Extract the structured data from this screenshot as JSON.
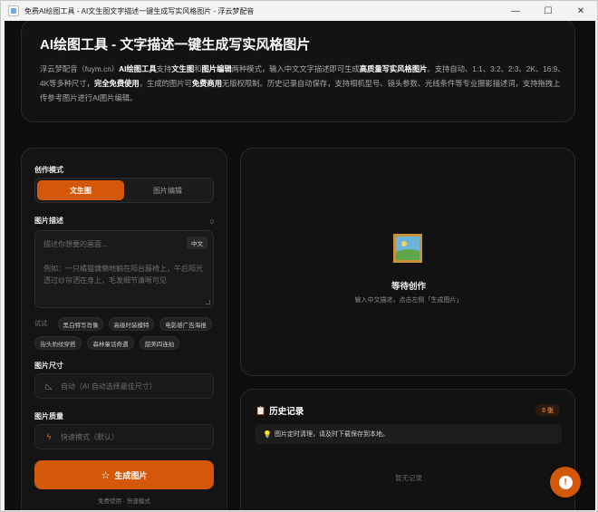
{
  "window": {
    "title": "免费AI绘图工具 - AI文生图文字描述一键生成写实风格图片 - 浮云梦配音",
    "minimize_glyph": "—",
    "maximize_glyph": "☐",
    "close_glyph": "✕"
  },
  "hero": {
    "title": "AI绘图工具 - 文字描述一键生成写实风格图片",
    "desc": [
      {
        "t": "浮云梦配音（fuym.cn）",
        "b": false
      },
      {
        "t": "AI绘图工具",
        "b": true
      },
      {
        "t": "支持",
        "b": false
      },
      {
        "t": "文生图",
        "b": true
      },
      {
        "t": "和",
        "b": false
      },
      {
        "t": "图片编辑",
        "b": true
      },
      {
        "t": "两种模式，输入中文文字描述即可生成",
        "b": false
      },
      {
        "t": "高质量写实风格图片",
        "b": true
      },
      {
        "t": "。支持自动、1:1、3:2、2:3、2K、16:9、4K等多种尺寸，",
        "b": false
      },
      {
        "t": "完全免费使用",
        "b": true
      },
      {
        "t": "，生成的图片可",
        "b": false
      },
      {
        "t": "免费商用",
        "b": true
      },
      {
        "t": "无版权限制。历史记录自动保存，支持相机型号、镜头参数、光线条件等专业摄影描述词，支持拖拽上传参考图片进行AI图片编辑。",
        "b": false
      }
    ]
  },
  "left": {
    "mode_label": "创作模式",
    "mode_tabs": [
      "文生图",
      "图片编辑"
    ],
    "active_mode": "文生图",
    "prompt_label": "图片描述",
    "char_count": "0",
    "prompt_placeholder": "描述你想要的画面...",
    "lang_badge": "中文",
    "prompt_example": "例如：一只橘猫慵懒地躺在阳台藤椅上，午后阳光透过纱帘洒在身上，毛发细节清晰可见",
    "try_label": "试试:",
    "chips": [
      "黑白特写肖像",
      "高级时装模特",
      "电影感广告海报",
      "街头豹纹穿搭",
      "森林童话奇遇",
      "甜美四连拍"
    ],
    "size_label": "图片尺寸",
    "size_value": "自动（AI 自动选择最佳尺寸）",
    "quality_label": "图片质量",
    "quality_value": "快速模式（默认）",
    "generate_label": "生成图片",
    "generate_sub": "免费使用 · 快速模式"
  },
  "preview": {
    "title": "等待创作",
    "subtitle": "输入中文描述，点击左侧「生成图片」"
  },
  "history": {
    "title": "历史记录",
    "count": "0 张",
    "note": "图片定时清理，请及时下载保存到本地。",
    "empty": "暂无记录"
  },
  "colors": {
    "accent": "#d4580a",
    "background": "#0e0e0e",
    "panel": "#141414"
  },
  "icons": {
    "ruler": "ruler-icon",
    "bolt": "bolt-icon",
    "star": "star-icon",
    "clipboard": "clipboard-icon",
    "bulb": "lightbulb-icon",
    "image": "image-placeholder-icon",
    "chat": "chat-support-icon"
  }
}
